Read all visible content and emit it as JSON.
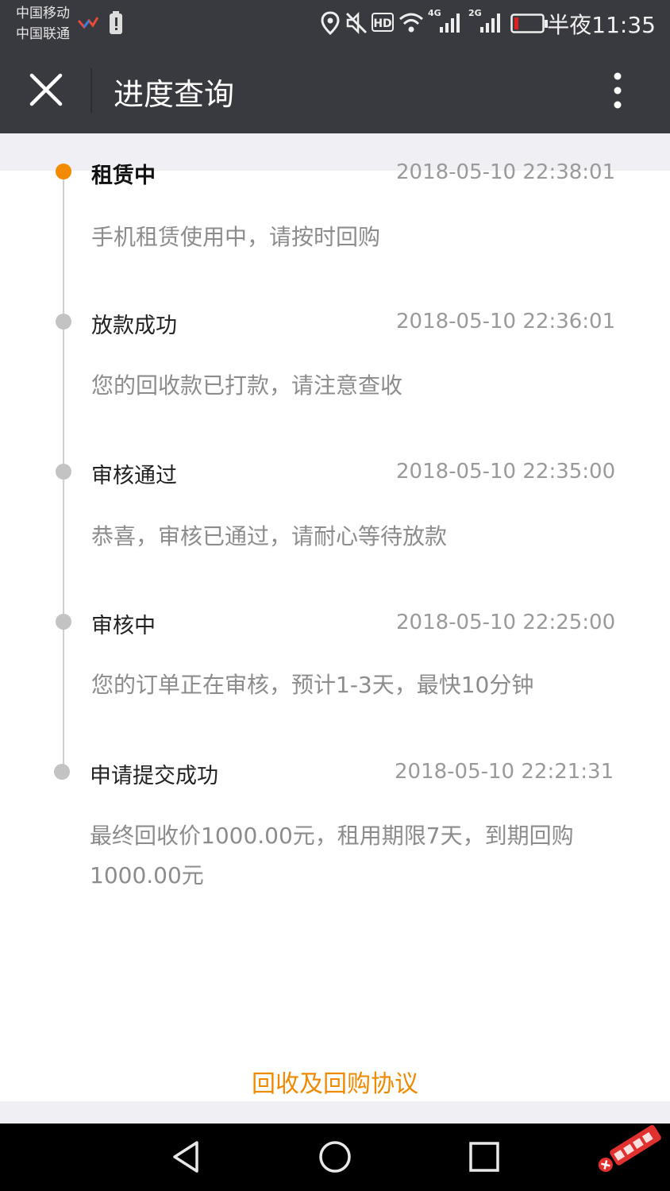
{
  "status_bar": {
    "carrier_1": "中国移动",
    "carrier_2": "中国联通",
    "network_1": "4G",
    "network_2": "2G",
    "hd_label": "HD",
    "time": "半夜11:35",
    "battery_color": "#e02020"
  },
  "header": {
    "title": "进度查询",
    "close_icon": "close-icon",
    "more_icon": "more-vertical-icon"
  },
  "timeline": {
    "steps": [
      {
        "title": "租赁中",
        "time": "2018-05-10 22:38:01",
        "desc": "手机租赁使用中，请按时回购",
        "active": true
      },
      {
        "title": "放款成功",
        "time": "2018-05-10 22:36:01",
        "desc": "您的回收款已打款，请注意查收",
        "active": false
      },
      {
        "title": "审核通过",
        "time": "2018-05-10 22:35:00",
        "desc": "恭喜，审核已通过，请耐心等待放款",
        "active": false
      },
      {
        "title": "审核中",
        "time": "2018-05-10 22:25:00",
        "desc": "您的订单正在审核，预计1-3天，最快10分钟",
        "active": false
      },
      {
        "title": "申请提交成功",
        "time": "2018-05-10 22:21:31",
        "desc": "最终回收价1000.00元，租用期限7天，到期回购1000.00元",
        "active": false
      }
    ]
  },
  "footer": {
    "agreement_link": "回收及回购协议"
  },
  "colors": {
    "accent": "#ef8a00",
    "header_bg": "#393a3f",
    "active_dot": "#f28b00",
    "inactive_dot": "#c3c3c3"
  },
  "nav_bar": {
    "back_icon": "back-triangle-icon",
    "home_icon": "home-circle-icon",
    "recents_icon": "recents-square-icon"
  },
  "watermark": {
    "text": "卡农社区"
  }
}
